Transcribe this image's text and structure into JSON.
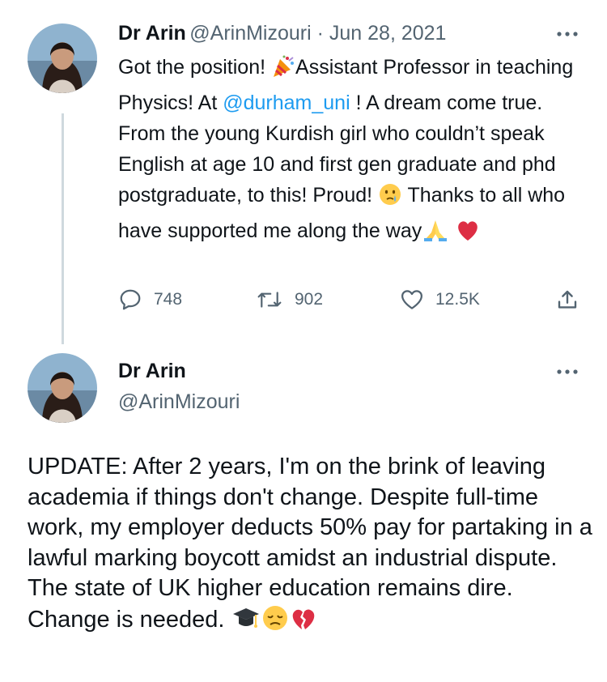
{
  "tweet1": {
    "author_name": "Dr Arin",
    "author_handle": "@ArinMizouri",
    "separator": " · ",
    "date": "Jun 28, 2021",
    "text_part1": "Got the position! ",
    "text_part2": "Assistant Professor in teaching Physics! At ",
    "mention": "@durham_uni",
    "text_part3": " ! A dream come true. From the young Kurdish girl who couldn’t speak English at age 10 and first gen graduate and phd postgraduate, to this! Proud! ",
    "text_part4": " Thanks to all who have supported me along the way",
    "emojis": [
      "party-popper",
      "crying-face",
      "folded-hands",
      "red-heart"
    ],
    "replies": "748",
    "retweets": "902",
    "likes": "12.5K"
  },
  "tweet2": {
    "author_name": "Dr Arin",
    "author_handle": "@ArinMizouri",
    "text": "UPDATE: After 2 years, I'm on the brink of leaving academia if things don't change. Despite full-time work, my employer deducts 50% pay for partaking in a lawful marking boycott amidst an industrial dispute. The state of UK higher education remains dire. Change is needed. ",
    "emojis": [
      "graduation-cap",
      "disappointed-face",
      "broken-heart"
    ]
  },
  "colors": {
    "text": "#0f1419",
    "secondary": "#536471",
    "link": "#1d9bf0",
    "heart": "#e0245e"
  }
}
